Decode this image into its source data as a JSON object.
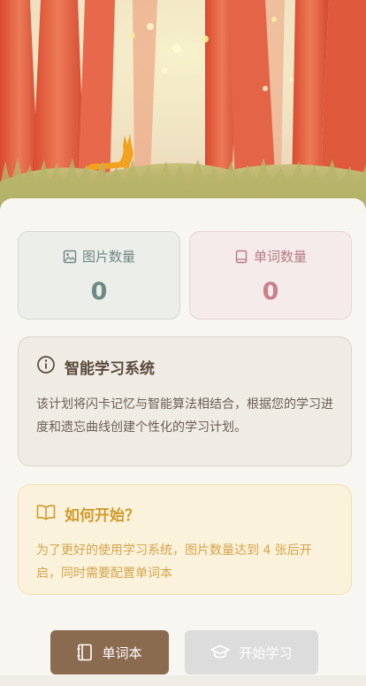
{
  "stats": {
    "images_label": "图片数量",
    "images_value": "0",
    "words_label": "单词数量",
    "words_value": "0"
  },
  "info": {
    "title": "智能学习系统",
    "body": "该计划将闪卡记忆与智能算法相结合，根据您的学习进度和遗忘曲线创建个性化的学习计划。"
  },
  "howto": {
    "title": "如何开始？",
    "body": "为了更好的使用学习系统，图片数量达到 4 张后开启，同时需要配置单词本"
  },
  "buttons": {
    "vocab_label": "单词本",
    "start_label": "开始学习"
  },
  "icons": {
    "images": "image-icon",
    "words": "notebook-icon",
    "info": "info-icon",
    "howto": "open-book-icon",
    "vocab": "book-icon",
    "start": "graduation-cap-icon"
  },
  "colors": {
    "vocab_button": "#8b6b50",
    "start_button_disabled": "#dcdcdc",
    "howto_accent": "#d19a2b"
  }
}
